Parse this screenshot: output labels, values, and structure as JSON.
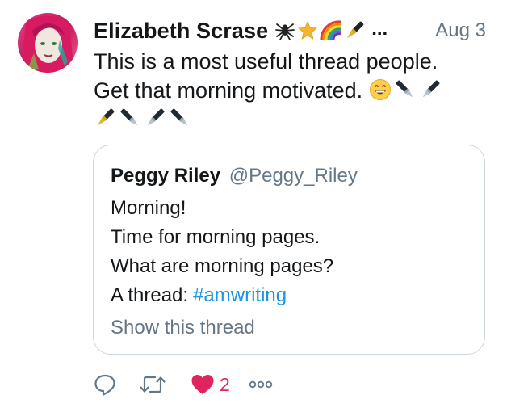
{
  "tweet": {
    "author_name": "Elizabeth Scrase",
    "name_emojis": [
      "spider-icon",
      "star-icon",
      "rainbow-icon",
      "fountain-pen-icon"
    ],
    "name_ellipsis": "...",
    "date": "Aug 3",
    "text_line1": "This is a most useful thread people.",
    "text_line2": "Get that morning motivated.",
    "text_emojis_line2": [
      "grinning-face-icon",
      "pen-icon",
      "pen-icon"
    ],
    "text_emojis_line3": [
      "fountain-pen-icon",
      "pen-icon",
      "pen-icon",
      "pen-icon"
    ]
  },
  "quoted_tweet": {
    "author_name": "Peggy Riley",
    "handle": "@Peggy_Riley",
    "lines": [
      "Morning!",
      "Time for morning pages.",
      "What are morning pages?"
    ],
    "thread_prefix": "A thread:",
    "hashtag": "#amwriting",
    "show_thread": "Show this thread"
  },
  "actions": {
    "reply_icon": "reply-icon",
    "retweet_icon": "retweet-icon",
    "like_icon": "heart-icon",
    "like_count": "2",
    "more_icon": "more-icon"
  },
  "colors": {
    "text": "#14171a",
    "secondary": "#657786",
    "link": "#1b95e0",
    "like": "#e0245e",
    "border": "#ccd6dd"
  }
}
